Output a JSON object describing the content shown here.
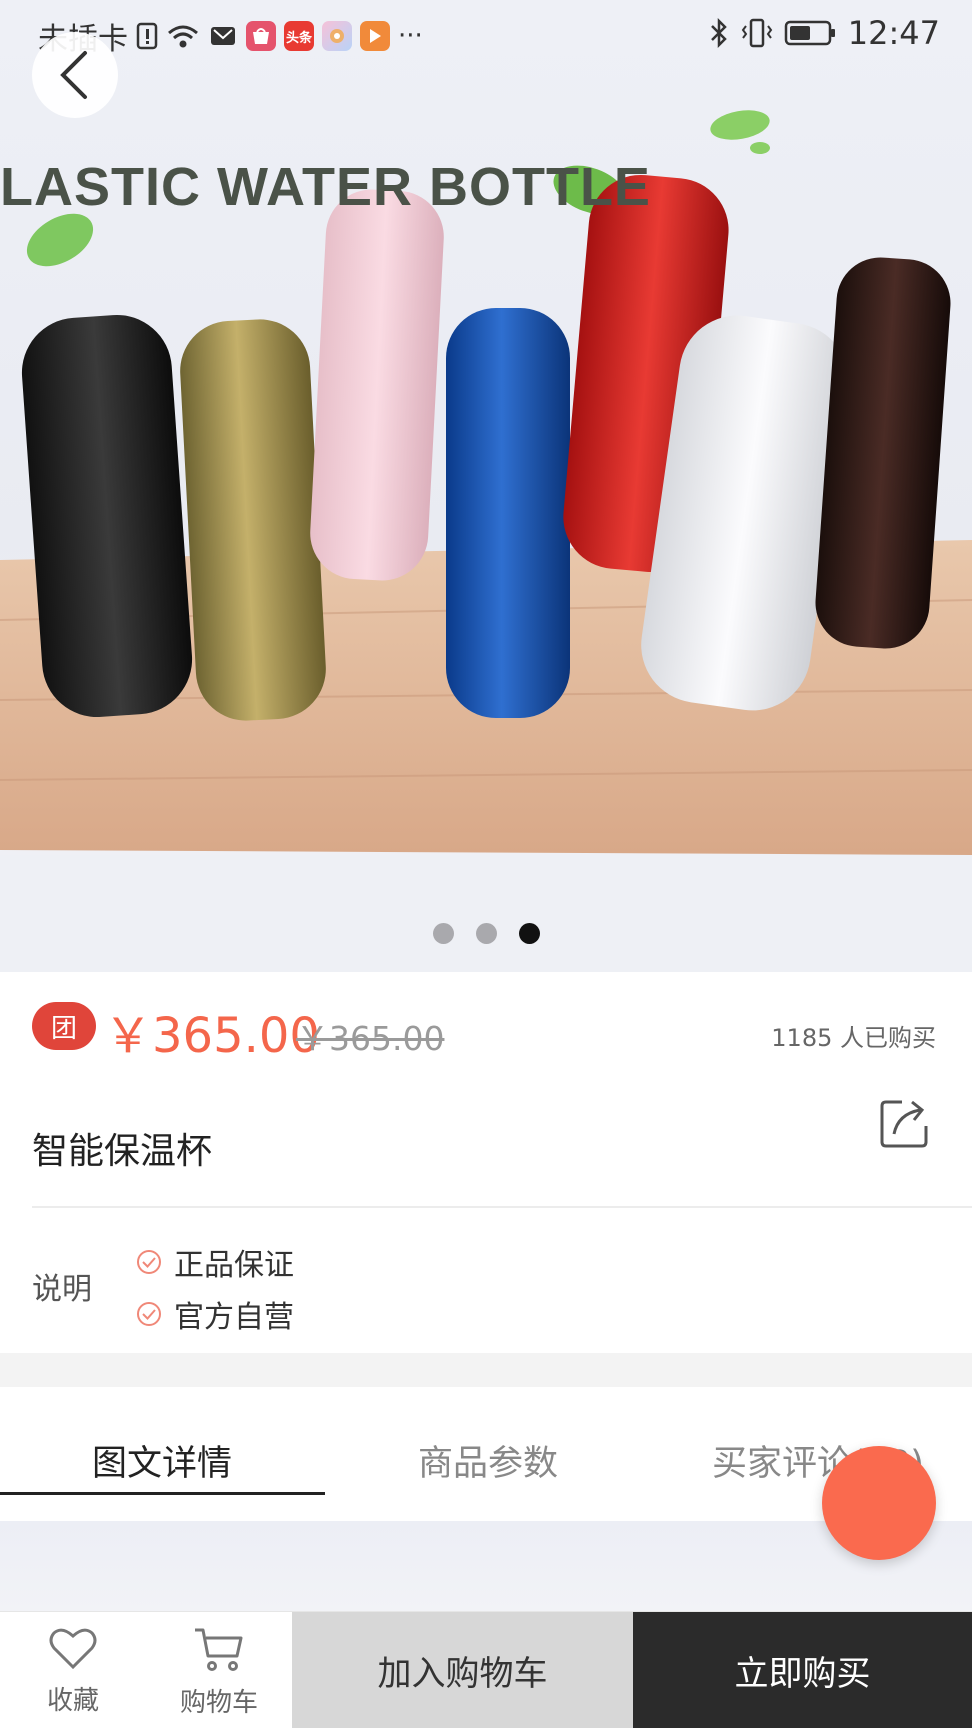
{
  "status_bar": {
    "carrier": "未插卡",
    "time": "12:47",
    "app_badges": [
      {
        "name": "vmall-app-icon",
        "text": "VMALL",
        "color": "#e5536c"
      },
      {
        "name": "toutiao-app-icon",
        "text": "头条",
        "color": "#e83a32"
      },
      {
        "name": "photos-app-icon",
        "text": "",
        "color": "#d9c9f0"
      },
      {
        "name": "video-app-icon",
        "text": "▶",
        "color": "#f18a3a"
      }
    ],
    "more": "···"
  },
  "hero": {
    "banner_text": "LASTIC WATER BOTTLE",
    "carousel_count": 3,
    "carousel_active_index": 2
  },
  "price": {
    "badge": "团",
    "current": "￥365.00",
    "original": "￥365.00",
    "sold": "1185 人已购买"
  },
  "product": {
    "title": "智能保温杯"
  },
  "description": {
    "label": "说明",
    "items": [
      "正品保证",
      "官方自营"
    ]
  },
  "tabs": [
    {
      "label": "图文详情",
      "active": true
    },
    {
      "label": "商品参数",
      "active": false
    },
    {
      "label": "买家评论(18)",
      "active": false
    }
  ],
  "bottom_bar": {
    "favorite_label": "收藏",
    "cart_label": "购物车",
    "add_to_cart_label": "加入购物车",
    "buy_now_label": "立即购买"
  },
  "colors": {
    "accent": "#f4664b",
    "badge_red": "#e0453a",
    "fab": "#fa6a4e",
    "buy_bg": "#2b2b2b",
    "add_cart_bg": "#d7d7d7"
  }
}
